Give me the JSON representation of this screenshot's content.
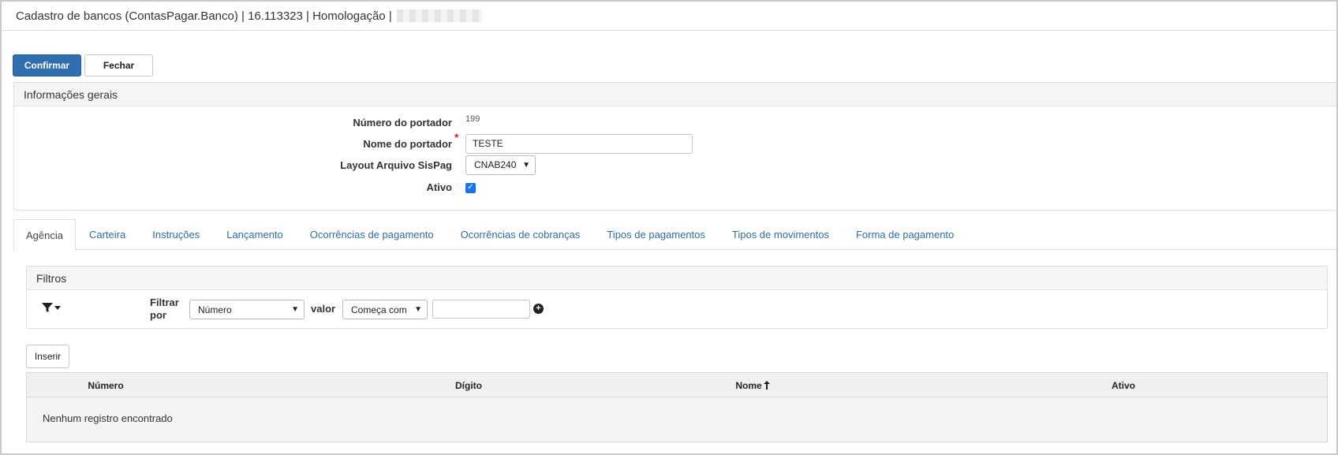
{
  "window": {
    "title": "Cadastro de bancos (ContasPagar.Banco) | 16.113323 | Homologação |"
  },
  "toolbar": {
    "confirm_label": "Confirmar",
    "close_label": "Fechar"
  },
  "general": {
    "section_title": "Informações gerais",
    "portador_numero_label": "Número do portador",
    "portador_numero_value": "199",
    "portador_nome_label": "Nome do portador",
    "portador_nome_value": "TESTE",
    "required_mark": "*",
    "layout_label": "Layout Arquivo SisPag",
    "layout_value": "CNAB240",
    "ativo_label": "Ativo",
    "ativo_checked": true
  },
  "tabs": [
    {
      "label": "Agência",
      "active": true
    },
    {
      "label": "Carteira",
      "active": false
    },
    {
      "label": "Instruções",
      "active": false
    },
    {
      "label": "Lançamento",
      "active": false
    },
    {
      "label": "Ocorrências de pagamento",
      "active": false
    },
    {
      "label": "Ocorrências de cobranças",
      "active": false
    },
    {
      "label": "Tipos de pagamentos",
      "active": false
    },
    {
      "label": "Tipos de movimentos",
      "active": false
    },
    {
      "label": "Forma de pagamento",
      "active": false
    }
  ],
  "filters": {
    "title": "Filtros",
    "filter_by_label": "Filtrar por",
    "field_value": "Número",
    "value_label": "valor",
    "operator_value": "Começa com",
    "search_value": ""
  },
  "grid": {
    "insert_label": "Inserir",
    "columns": [
      "Número",
      "Dígito",
      "Nome",
      "Ativo"
    ],
    "sort_column": "Nome",
    "sort_direction": "asc",
    "empty_message": "Nenhum registro encontrado"
  },
  "colors": {
    "primary": "#2f6fb0",
    "link": "#2e6da4",
    "required": "#d9262b",
    "checkbox": "#1a73e8"
  }
}
